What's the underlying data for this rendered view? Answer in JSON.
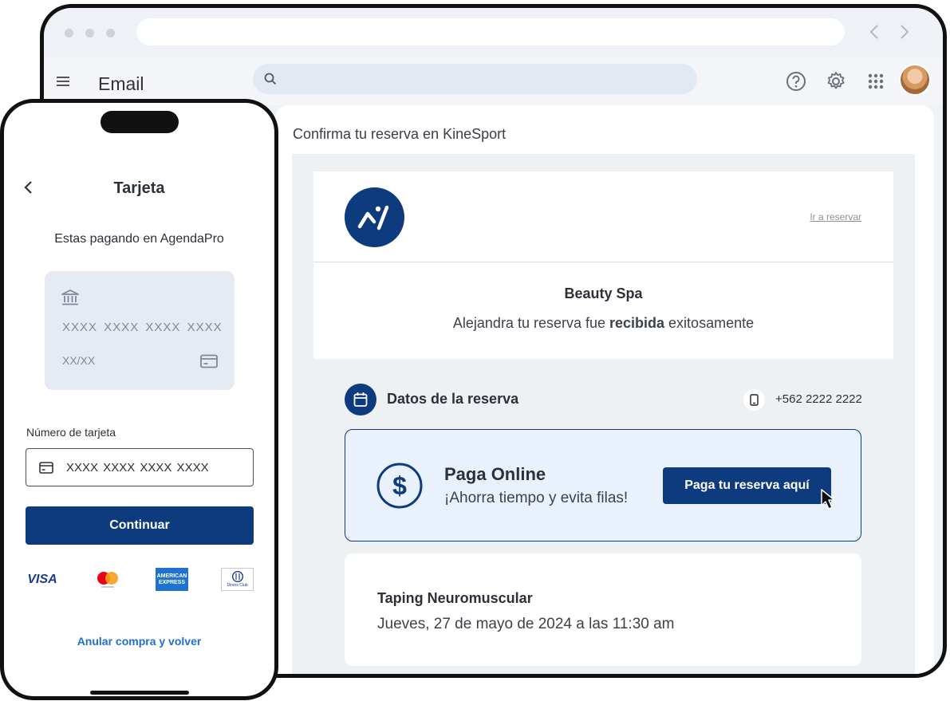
{
  "browser": {
    "app_title": "Email",
    "search_placeholder": ""
  },
  "email": {
    "subject": "Confirma tu reserva en KineSport",
    "link_text": "Ir a reservar",
    "business_name": "Beauty Spa",
    "intro_before": "Alejandra tu reserva fue ",
    "intro_bold": "recibida",
    "intro_after": " exitosamente",
    "details_title": "Datos de la reserva",
    "phone": "+562 2222 2222",
    "pay_title": "Paga Online",
    "pay_subtitle": "¡Ahorra tiempo y evita filas!",
    "pay_button": "Paga tu reserva aquí",
    "service_name": "Taping Neuromuscular",
    "service_datetime": "Jueves, 27 de mayo de 2024  a las 11:30 am"
  },
  "phone_app": {
    "screen_title": "Tarjeta",
    "paying_text": "Estas pagando en AgendaPro",
    "card_number_preview": "XXXX XXXX XXXX XXXX",
    "card_expiry_preview": "XX/XX",
    "card_number_label": "Número de tarjeta",
    "card_number_placeholder": "XXXX XXXX XXXX XXXX",
    "continue_button": "Continuar",
    "brands": {
      "visa": "VISA",
      "amex_line1": "AMERICAN",
      "amex_line2": "EXPRESS",
      "diners": "Diners Club"
    },
    "cancel_link": "Anular compra y volver"
  },
  "colors": {
    "primary": "#0e3a7e",
    "link": "#1f6fd1",
    "pay_box_bg": "#e9f1fc"
  },
  "icons": [
    "menu-icon",
    "search-icon",
    "help-icon",
    "gear-icon",
    "apps-grid-icon",
    "back-chevron-icon",
    "forward-chevron-icon",
    "calendar-icon",
    "mobile-phone-icon",
    "dollar-icon",
    "cursor-icon",
    "bank-icon",
    "credit-card-icon",
    "chevron-left-icon"
  ]
}
